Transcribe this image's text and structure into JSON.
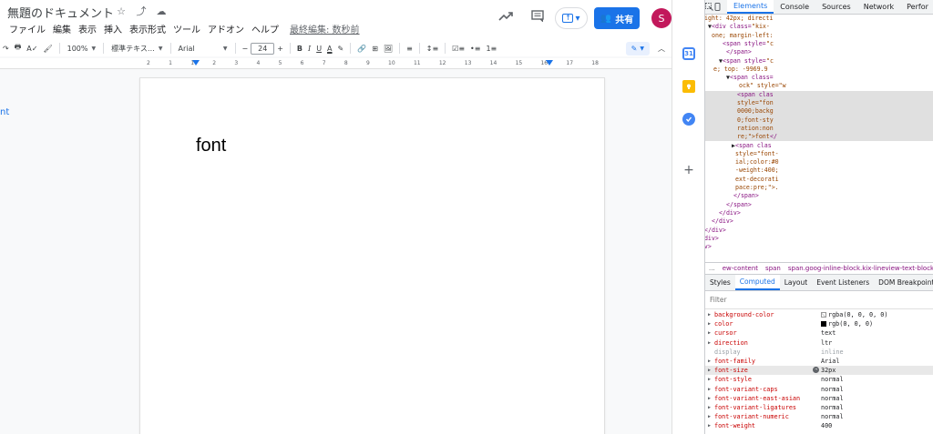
{
  "docs": {
    "title": "無題のドキュメント",
    "title_icons": [
      "☆",
      "⤴",
      "☁"
    ],
    "menu": [
      "ファイル",
      "編集",
      "表示",
      "挿入",
      "表示形式",
      "ツール",
      "アドオン",
      "ヘルプ"
    ],
    "last_edit": "最終編集: 数秒前",
    "share_label": "共有",
    "share_icon": "👥",
    "avatar_letter": "S",
    "toolbar": {
      "redo": "↷",
      "print": "🖶",
      "spell": "A✓",
      "paint": "🖌",
      "zoom": "100%",
      "style": "標準テキス…",
      "font": "Arial",
      "minus": "−",
      "font_size": "24",
      "plus": "+",
      "bold": "B",
      "italic": "I",
      "underline": "U",
      "text_color": "A",
      "highlight": "✎",
      "link": "🔗",
      "comment": "⊞",
      "image": "🖼",
      "align": "≡",
      "line_spacing": "↕≡",
      "checklist": "☑≡",
      "bullets": "•≡",
      "numbered": "1≡",
      "edit_mode": "✎",
      "collapse": "︿"
    },
    "ruler_numbers": [
      "2",
      "1",
      "1",
      "2",
      "3",
      "4",
      "5",
      "6",
      "7",
      "8",
      "9",
      "10",
      "11",
      "12",
      "13",
      "14",
      "15",
      "16",
      "17",
      "18"
    ],
    "outline_text": "nt",
    "page_text": "font"
  },
  "side_panel": {
    "calendar_label": "31",
    "plus": "+"
  },
  "devtools": {
    "tabs": [
      "Elements",
      "Console",
      "Sources",
      "Network",
      "Perfor"
    ],
    "active_tab": "Elements",
    "dom_lines": [
      {
        "indent": 172,
        "parts": [
          {
            "c": "attr",
            "t": "ight: 42px; directi"
          }
        ]
      },
      {
        "indent": 176,
        "parts": [
          {
            "c": "txt",
            "t": "▼"
          },
          {
            "c": "tag",
            "t": "<div class="
          },
          {
            "c": "attr",
            "t": "\"kix-"
          }
        ]
      },
      {
        "indent": 180,
        "parts": [
          {
            "c": "attr",
            "t": "one; margin-left:"
          }
        ]
      },
      {
        "indent": 192,
        "parts": [
          {
            "c": "tag",
            "t": "<span style="
          },
          {
            "c": "attr",
            "t": "\"c"
          }
        ]
      },
      {
        "indent": 196,
        "parts": [
          {
            "c": "tag",
            "t": "</span>"
          }
        ]
      },
      {
        "indent": 188,
        "parts": [
          {
            "c": "txt",
            "t": "▼"
          },
          {
            "c": "tag",
            "t": "<span style="
          },
          {
            "c": "attr",
            "t": "\"c"
          }
        ]
      },
      {
        "indent": 182,
        "parts": [
          {
            "c": "attr",
            "t": "e; top: -9969.9"
          }
        ]
      },
      {
        "indent": 196,
        "parts": [
          {
            "c": "txt",
            "t": "▼"
          },
          {
            "c": "tag",
            "t": "<span class="
          }
        ]
      },
      {
        "indent": 210,
        "parts": [
          {
            "c": "attr",
            "t": "ock\" style=\"w"
          }
        ]
      },
      {
        "indent": 208,
        "hl": true,
        "parts": [
          {
            "c": "tag",
            "t": "<span clas"
          }
        ]
      },
      {
        "indent": 208,
        "hl": true,
        "parts": [
          {
            "c": "attr",
            "t": "style=\"fon"
          }
        ]
      },
      {
        "indent": 208,
        "hl": true,
        "parts": [
          {
            "c": "attr",
            "t": "0000;backg"
          }
        ]
      },
      {
        "indent": 208,
        "hl": true,
        "parts": [
          {
            "c": "attr",
            "t": "0;font-sty"
          }
        ]
      },
      {
        "indent": 208,
        "hl": true,
        "parts": [
          {
            "c": "attr",
            "t": "ration:non"
          }
        ]
      },
      {
        "indent": 208,
        "hl": true,
        "parts": [
          {
            "c": "attr",
            "t": "re;\">font"
          },
          {
            "c": "tag",
            "t": "</"
          }
        ]
      },
      {
        "indent": 202,
        "parts": [
          {
            "c": "txt",
            "t": "▶"
          },
          {
            "c": "tag",
            "t": "<span clas"
          }
        ]
      },
      {
        "indent": 206,
        "parts": [
          {
            "c": "attr",
            "t": "style=\"font-"
          }
        ]
      },
      {
        "indent": 206,
        "parts": [
          {
            "c": "attr",
            "t": "ial;color:#0"
          }
        ]
      },
      {
        "indent": 206,
        "parts": [
          {
            "c": "attr",
            "t": "-weight:400;"
          }
        ]
      },
      {
        "indent": 206,
        "parts": [
          {
            "c": "attr",
            "t": "ext-decorati"
          }
        ]
      },
      {
        "indent": 206,
        "parts": [
          {
            "c": "attr",
            "t": "pace:pre;\">."
          }
        ]
      },
      {
        "indent": 204,
        "parts": [
          {
            "c": "tag",
            "t": "</span>"
          }
        ]
      },
      {
        "indent": 196,
        "parts": [
          {
            "c": "tag",
            "t": "</span>"
          }
        ]
      },
      {
        "indent": 188,
        "parts": [
          {
            "c": "tag",
            "t": "</div>"
          }
        ]
      },
      {
        "indent": 180,
        "parts": [
          {
            "c": "tag",
            "t": "</div>"
          }
        ]
      },
      {
        "indent": 172,
        "parts": [
          {
            "c": "tag",
            "t": "</div>"
          }
        ]
      },
      {
        "indent": 164,
        "parts": [
          {
            "c": "tag",
            "t": "</div>"
          }
        ]
      },
      {
        "indent": 156,
        "parts": [
          {
            "c": "tag",
            "t": "</div>"
          }
        ]
      },
      {
        "indent": 148,
        "parts": [
          {
            "c": "tag",
            "t": "</div>"
          }
        ]
      }
    ],
    "gutter_dots": "…",
    "breadcrumbs": [
      "...",
      "ew-content",
      "span",
      "span.goog-inline-block.kix-lineview-text-block"
    ],
    "sub_tabs": [
      "Styles",
      "Computed",
      "Layout",
      "Event Listeners",
      "DOM Breakpoints"
    ],
    "active_sub_tab": "Computed",
    "filter_placeholder": "Filter",
    "computed": [
      {
        "name": "background-color",
        "value": "rgba(0, 0, 0, 0)",
        "swatch": "empty"
      },
      {
        "name": "color",
        "value": "rgb(0, 0, 0)",
        "swatch": "black"
      },
      {
        "name": "cursor",
        "value": "text"
      },
      {
        "name": "direction",
        "value": "ltr"
      },
      {
        "name": "display",
        "value": "inline",
        "inherited": true
      },
      {
        "name": "font-family",
        "value": "Arial"
      },
      {
        "name": "font-size",
        "value": "32px",
        "selected": true,
        "override": true
      },
      {
        "name": "font-style",
        "value": "normal"
      },
      {
        "name": "font-variant-caps",
        "value": "normal"
      },
      {
        "name": "font-variant-east-asian",
        "value": "normal"
      },
      {
        "name": "font-variant-ligatures",
        "value": "normal"
      },
      {
        "name": "font-variant-numeric",
        "value": "normal"
      },
      {
        "name": "font-weight",
        "value": "400"
      }
    ]
  }
}
